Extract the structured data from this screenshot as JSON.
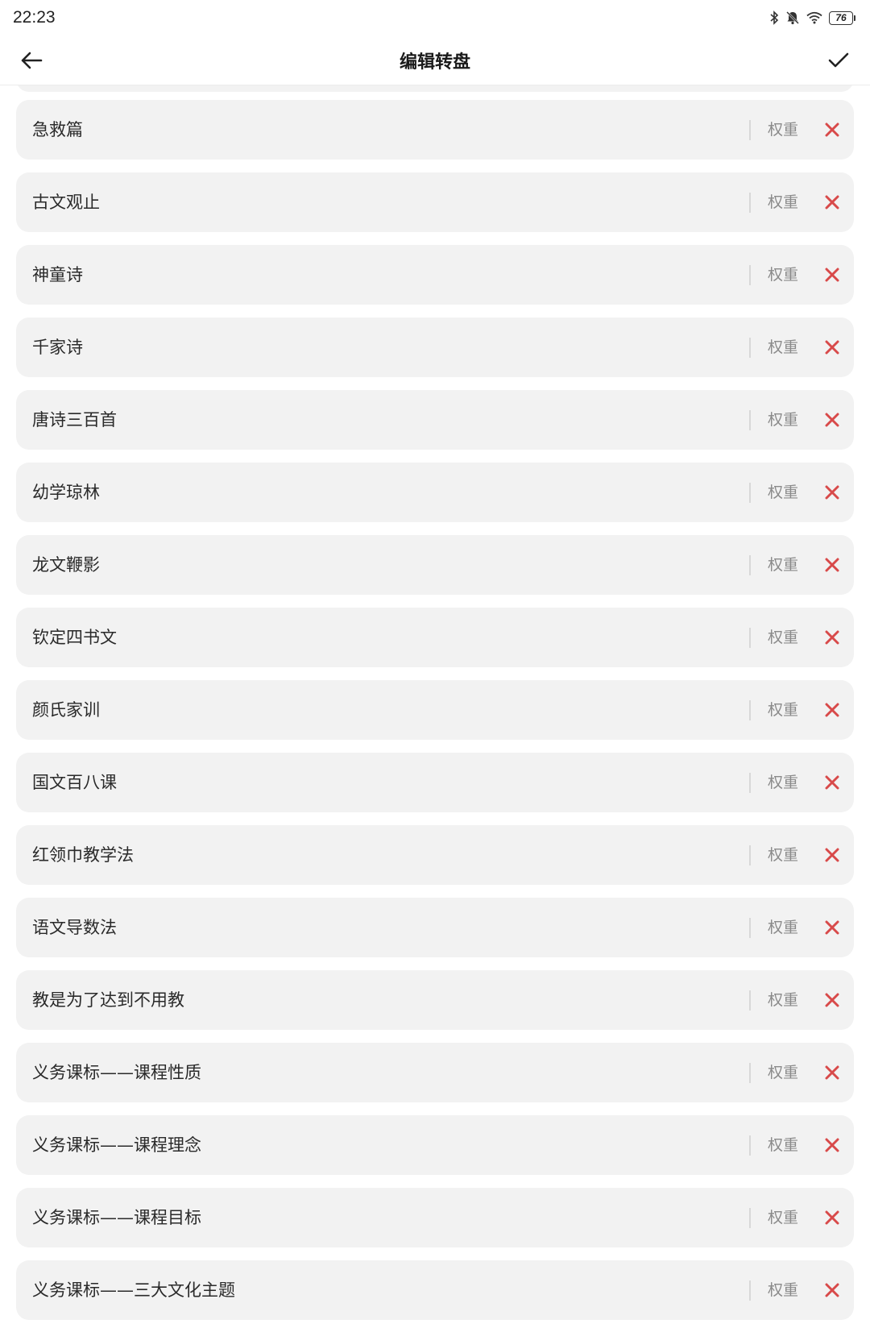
{
  "status_bar": {
    "time": "22:23",
    "icons": [
      "bluetooth-icon",
      "mute-bell-icon",
      "wifi-icon",
      "battery-icon"
    ],
    "battery_level": "76"
  },
  "app_bar": {
    "title": "编辑转盘",
    "back_icon": "arrow-left-icon",
    "confirm_icon": "check-icon"
  },
  "colors": {
    "card_bg": "#f2f2f2",
    "delete_red": "#d84a4a",
    "weight_text": "#8a8a8a"
  },
  "items": [
    {
      "label": "急救篇",
      "weight_label": "权重"
    },
    {
      "label": "古文观止",
      "weight_label": "权重"
    },
    {
      "label": "神童诗",
      "weight_label": "权重"
    },
    {
      "label": "千家诗",
      "weight_label": "权重"
    },
    {
      "label": "唐诗三百首",
      "weight_label": "权重"
    },
    {
      "label": "幼学琼林",
      "weight_label": "权重"
    },
    {
      "label": "龙文鞭影",
      "weight_label": "权重"
    },
    {
      "label": "钦定四书文",
      "weight_label": "权重"
    },
    {
      "label": "颜氏家训",
      "weight_label": "权重"
    },
    {
      "label": "国文百八课",
      "weight_label": "权重"
    },
    {
      "label": "红领巾教学法",
      "weight_label": "权重"
    },
    {
      "label": "语文导数法",
      "weight_label": "权重"
    },
    {
      "label": "教是为了达到不用教",
      "weight_label": "权重"
    },
    {
      "label": "义务课标——课程性质",
      "weight_label": "权重"
    },
    {
      "label": "义务课标——课程理念",
      "weight_label": "权重"
    },
    {
      "label": "义务课标——课程目标",
      "weight_label": "权重"
    },
    {
      "label": "义务课标——三大文化主题",
      "weight_label": "权重"
    }
  ]
}
